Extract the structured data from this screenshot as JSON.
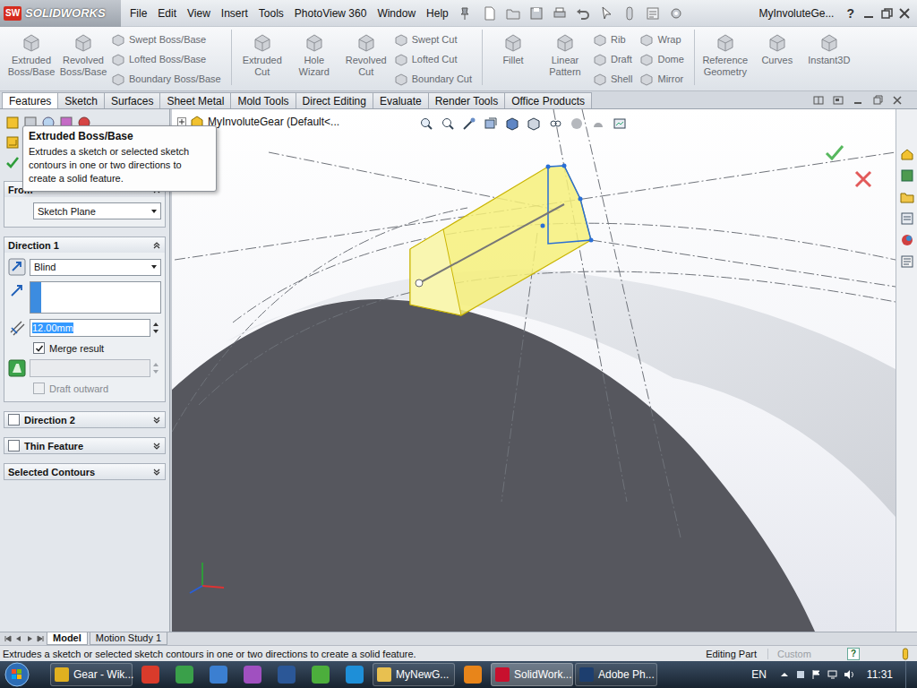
{
  "window": {
    "logo_mark": "SW",
    "app": "SOLIDWORKS",
    "title": "MyInvoluteGe...",
    "help": "?"
  },
  "menu": [
    "File",
    "Edit",
    "View",
    "Insert",
    "Tools",
    "PhotoView 360",
    "Window",
    "Help"
  ],
  "ribbon": [
    {
      "kind": "large",
      "items": [
        {
          "label": "Extruded Boss/Base",
          "disabled": true
        },
        {
          "label": "Revolved Boss/Base",
          "disabled": true
        }
      ]
    },
    {
      "kind": "stack",
      "items": [
        {
          "label": "Swept Boss/Base",
          "disabled": true
        },
        {
          "label": "Lofted Boss/Base",
          "disabled": true
        },
        {
          "label": "Boundary Boss/Base",
          "disabled": true
        }
      ]
    },
    {
      "kind": "large",
      "items": [
        {
          "label": "Extruded Cut",
          "disabled": true
        },
        {
          "label": "Hole Wizard",
          "disabled": true
        },
        {
          "label": "Revolved Cut",
          "disabled": true
        }
      ]
    },
    {
      "kind": "stack",
      "items": [
        {
          "label": "Swept Cut",
          "disabled": true
        },
        {
          "label": "Lofted Cut",
          "disabled": true
        },
        {
          "label": "Boundary Cut",
          "disabled": true
        }
      ]
    },
    {
      "kind": "large",
      "items": [
        {
          "label": "Fillet",
          "disabled": true
        },
        {
          "label": "Linear Pattern",
          "disabled": true
        }
      ]
    },
    {
      "kind": "stack",
      "items": [
        {
          "label": "Rib",
          "disabled": true
        },
        {
          "label": "Draft",
          "disabled": true
        },
        {
          "label": "Shell",
          "disabled": true
        }
      ]
    },
    {
      "kind": "stack",
      "items": [
        {
          "label": "Wrap",
          "disabled": true
        },
        {
          "label": "Dome",
          "disabled": true
        },
        {
          "label": "Mirror",
          "disabled": true
        }
      ]
    },
    {
      "kind": "large",
      "items": [
        {
          "label": "Reference Geometry",
          "disabled": true
        },
        {
          "label": "Curves",
          "disabled": true
        },
        {
          "label": "Instant3D",
          "disabled": true
        }
      ]
    }
  ],
  "tabs": [
    {
      "label": "Features",
      "selected": true
    },
    {
      "label": "Sketch",
      "selected": false
    },
    {
      "label": "Surfaces",
      "selected": false
    },
    {
      "label": "Sheet Metal",
      "selected": false
    },
    {
      "label": "Mold Tools",
      "selected": false
    },
    {
      "label": "Direct Editing",
      "selected": false
    },
    {
      "label": "Evaluate",
      "selected": false
    },
    {
      "label": "Render Tools",
      "selected": false
    },
    {
      "label": "Office Products",
      "selected": false
    }
  ],
  "tooltip": {
    "title": "Extruded Boss/Base",
    "text": "Extrudes a sketch or selected sketch contours in one or two directions to create a solid feature."
  },
  "property_manager": {
    "from": {
      "title": "From",
      "expanded": true,
      "value": "Sketch Plane"
    },
    "direction1": {
      "title": "Direction 1",
      "expanded": true,
      "end_condition": "Blind",
      "direction_reference": "",
      "depth": "12.00mm",
      "depth_selected": true,
      "merge_result": {
        "label": "Merge result",
        "checked": true,
        "disabled": false
      },
      "draft_angle": "",
      "draft_enabled": false,
      "draft_outward": {
        "label": "Draft outward",
        "checked": false,
        "disabled": true
      }
    },
    "sections": [
      {
        "title": "Direction 2",
        "kind": "checkbox",
        "checked": false,
        "expanded": false
      },
      {
        "title": "Thin Feature",
        "kind": "checkbox",
        "checked": false,
        "expanded": false
      },
      {
        "title": "Selected Contours",
        "kind": "plain",
        "expanded": false
      }
    ]
  },
  "viewport": {
    "tree_label": "MyInvoluteGear (Default<..."
  },
  "model_tabs": [
    {
      "label": "Model",
      "selected": true
    },
    {
      "label": "Motion Study 1",
      "selected": false
    }
  ],
  "status_bar": {
    "message": "Extrudes a sketch or selected sketch contours in one or two directions to create a solid feature.",
    "mode": "Editing Part",
    "custom": "Custom",
    "custom_disabled": true,
    "help": "?"
  },
  "taskbar": {
    "items": [
      {
        "kind": "window",
        "label": "Gear - Wik...",
        "active": false
      },
      {
        "kind": "pinned",
        "active": false
      },
      {
        "kind": "pinned",
        "active": false
      },
      {
        "kind": "pinned",
        "active": false
      },
      {
        "kind": "pinned",
        "active": false
      },
      {
        "kind": "pinned",
        "active": false
      },
      {
        "kind": "pinned",
        "active": false
      },
      {
        "kind": "pinned",
        "active": false
      },
      {
        "kind": "window",
        "label": "MyNewG...",
        "active": false
      },
      {
        "kind": "pinned",
        "active": false
      },
      {
        "kind": "window",
        "label": "SolidWork...",
        "active": true
      },
      {
        "kind": "window",
        "label": "Adobe Ph...",
        "active": false
      }
    ],
    "language": "EN",
    "time": "11:31"
  }
}
